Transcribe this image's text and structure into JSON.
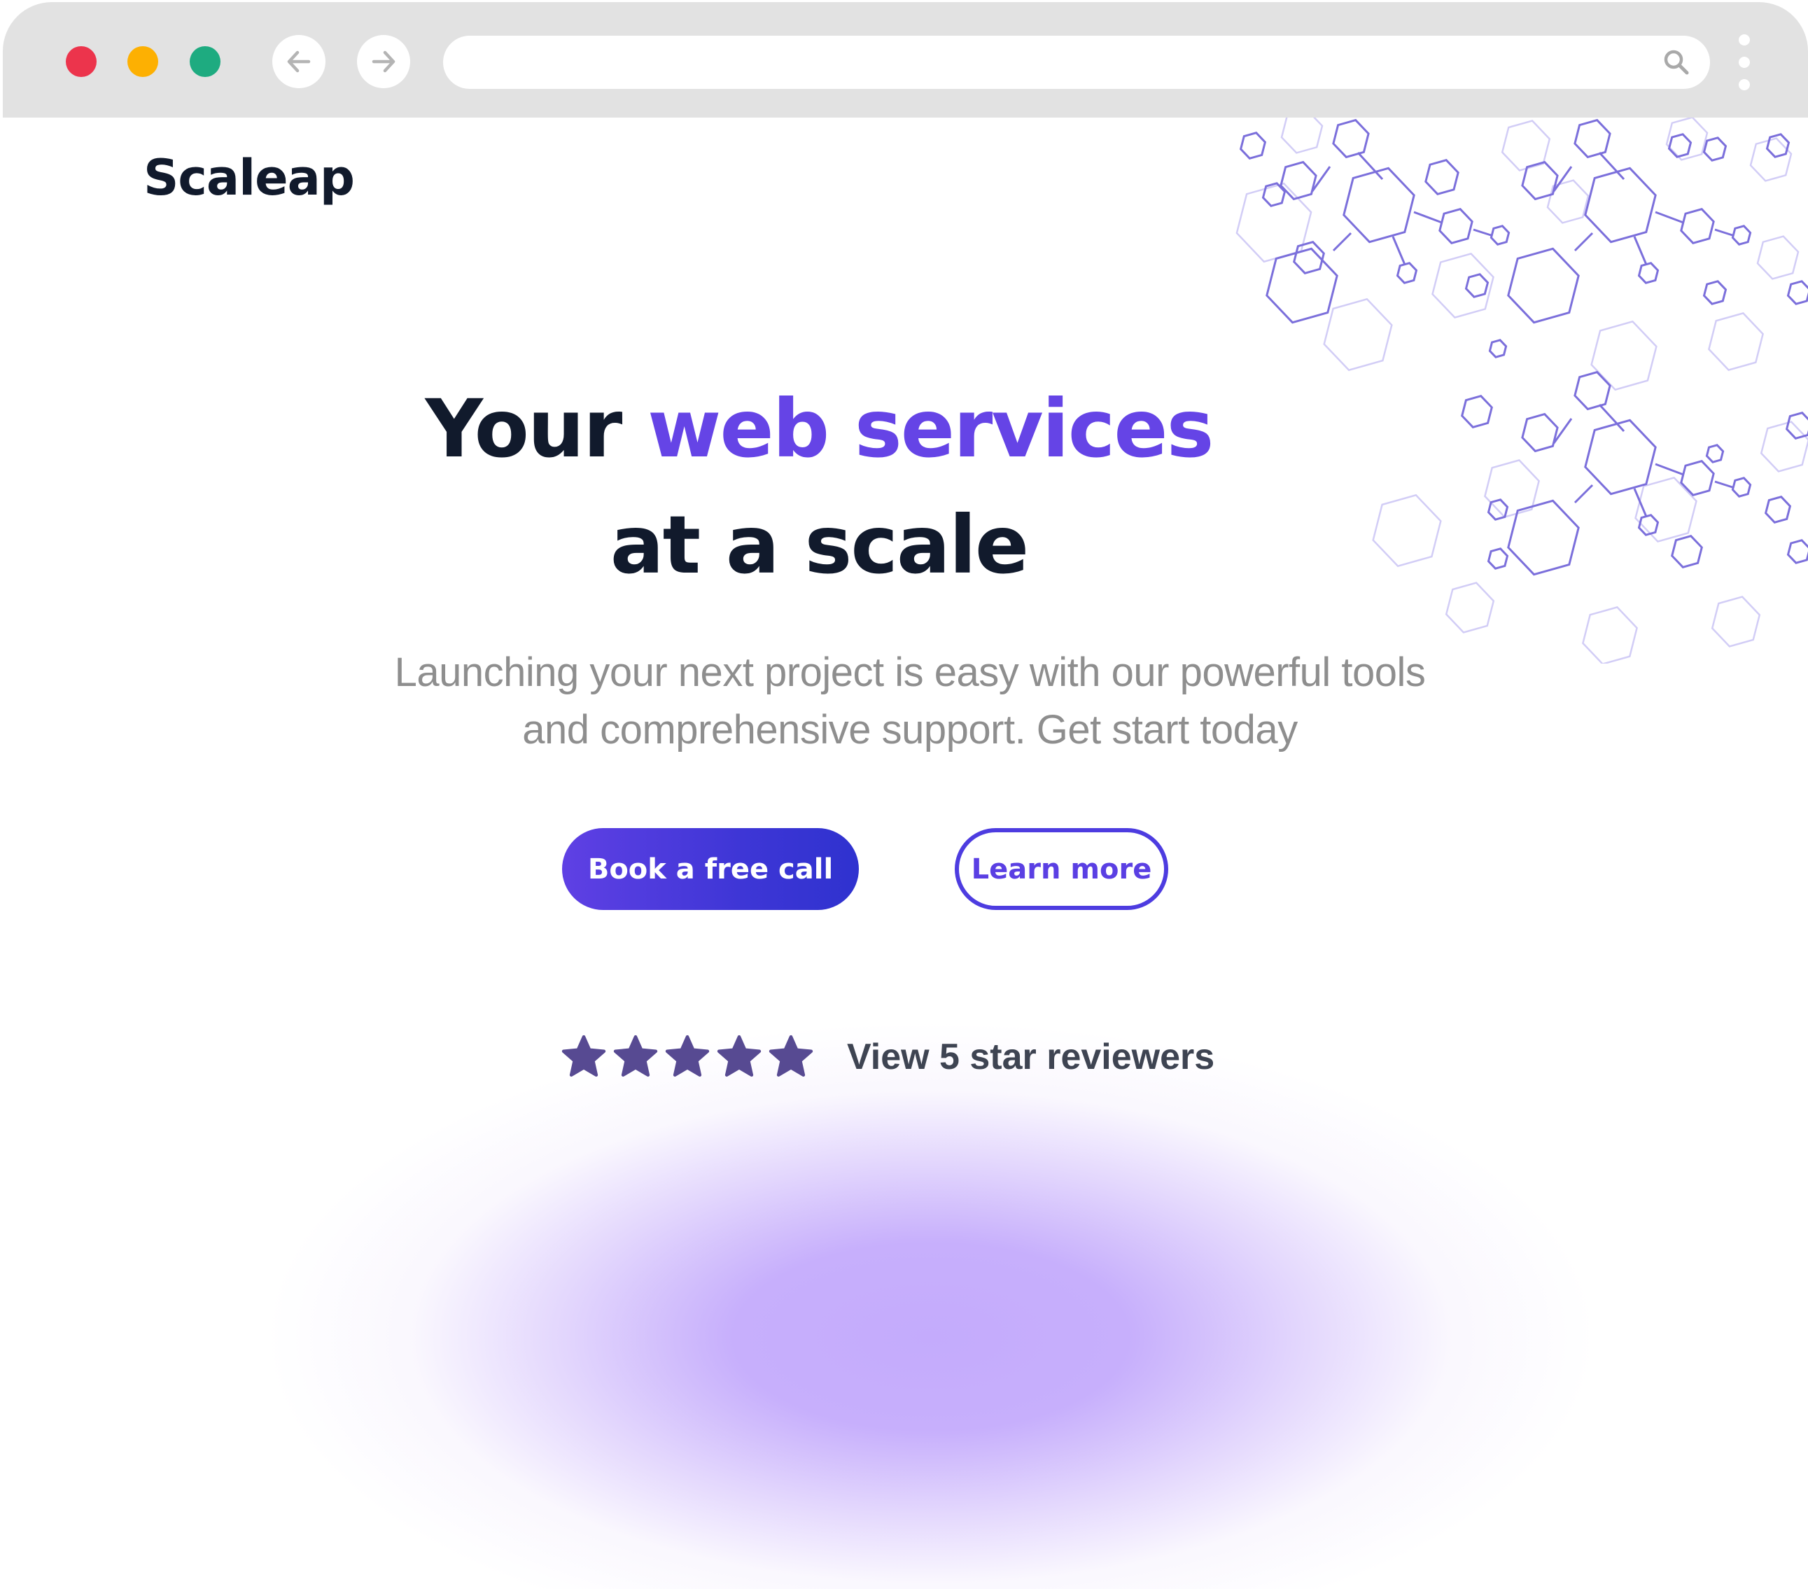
{
  "browser": {
    "window_controls": [
      "close",
      "minimize",
      "maximize"
    ],
    "back_icon": "arrow-left-icon",
    "forward_icon": "arrow-right-icon",
    "address": {
      "value": "",
      "placeholder": ""
    },
    "search_icon": "magnifier-icon",
    "menu_icon": "kebab-menu-icon"
  },
  "page": {
    "logo": "Scaleap",
    "headline": {
      "prefix": "Your ",
      "accent": "web services",
      "line2": "at a scale"
    },
    "subtext": {
      "line1": "Launching your next project is easy with our powerful tools",
      "line2": "and comprehensive support. Get start today"
    },
    "cta": {
      "primary_label": "Book a free call",
      "secondary_label": "Learn more"
    },
    "reviews": {
      "rating": 5,
      "max_rating": 5,
      "link_label": "View 5 star reviewers"
    }
  },
  "colors": {
    "accent": "#6544E6",
    "heading": "#111A2C",
    "body_text": "#8E8E8E",
    "star": "#574A92",
    "button_gradient": [
      "#5F40E4",
      "#2F32CF"
    ],
    "glow": "#C4ABFC",
    "traffic_red": "#EC344C",
    "traffic_yellow": "#FDB002",
    "traffic_green": "#1EAB80"
  }
}
